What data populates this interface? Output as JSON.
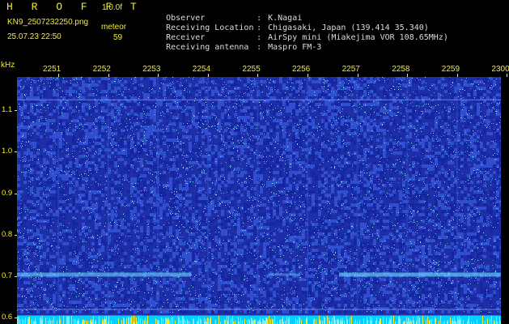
{
  "header": {
    "title": "H R O F F T",
    "version": "1.0.0f",
    "filename": "KN9_2507232250.png",
    "meteor_label": "meteor",
    "datetime": "25.07.23 22:50",
    "meteor_count": "59"
  },
  "info": [
    {
      "key": "Observer",
      "value": "K.Nagai"
    },
    {
      "key": "Receiving Location",
      "value": "Chigasaki, Japan (139.414 35.340)"
    },
    {
      "key": "Receiver",
      "value": "AirSpy mini (Miakejima VOR 108.65MHz)"
    },
    {
      "key": "Receiving antenna",
      "value": "Maspro FM-3"
    }
  ],
  "chart_data": {
    "type": "heatmap",
    "yunit": "kHz",
    "x_tick_labels": [
      "2251",
      "2252",
      "2253",
      "2254",
      "2255",
      "2256",
      "2257",
      "2258",
      "2259",
      "2300"
    ],
    "y_tick_labels": [
      "1.1",
      "1.0",
      "0.9",
      "0.8",
      "0.7",
      "0.6"
    ],
    "y_tick_values": [
      1.1,
      1.0,
      0.9,
      0.8,
      0.7,
      0.6
    ],
    "ylim": [
      0.585,
      1.18
    ],
    "xlim": [
      2250.6,
      2300
    ],
    "carrier_khz": 0.705,
    "reference_lines_khz": [
      1.125,
      0.62,
      0.605
    ],
    "colors": {
      "background": "#1e2ea6",
      "noise_dark": "#1626a0",
      "noise_mid": "#2f4fd0",
      "noise_light": "#4fa0ff",
      "speck": "#8fe0ff",
      "carrier": "#6fe6ff",
      "bottom_bar": "#00d0ff",
      "bottom_spike": "#f2ea30",
      "label": "#f2ea30"
    }
  }
}
